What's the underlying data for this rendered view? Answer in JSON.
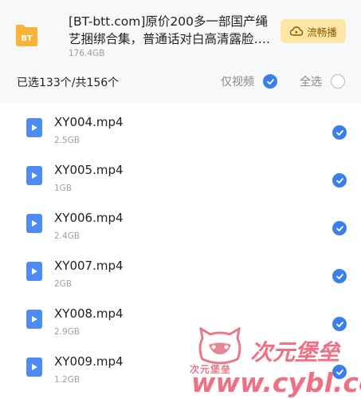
{
  "header": {
    "title": "[BT-btt.com]原价200多一部国产绳艺捆绑合集，普通话对白高清露脸….",
    "folder_badge": "BT",
    "size": "176.4GB",
    "play_label": "流畅播",
    "selection_count": "已选133个/共156个",
    "only_video_label": "仅视频",
    "select_all_label": "全选"
  },
  "files": [
    {
      "name": "XY004.mp4",
      "size": "2.5GB"
    },
    {
      "name": "XY005.mp4",
      "size": "1GB"
    },
    {
      "name": "XY006.mp4",
      "size": "2.4GB"
    },
    {
      "name": "XY007.mp4",
      "size": "2GB"
    },
    {
      "name": "XY008.mp4",
      "size": "2.9GB"
    },
    {
      "name": "XY009.mp4",
      "size": "1.2GB"
    }
  ],
  "watermark": {
    "small_text": "次元堡垒",
    "big_text": "次元堡垒",
    "url_text": "www.cybl.cc"
  },
  "colors": {
    "accent": "#3a7ff0",
    "header_bg": "#f7f8fa",
    "play_bg": "#fde5a6",
    "folder": "#f9b437",
    "watermark": "#ef6f84"
  }
}
